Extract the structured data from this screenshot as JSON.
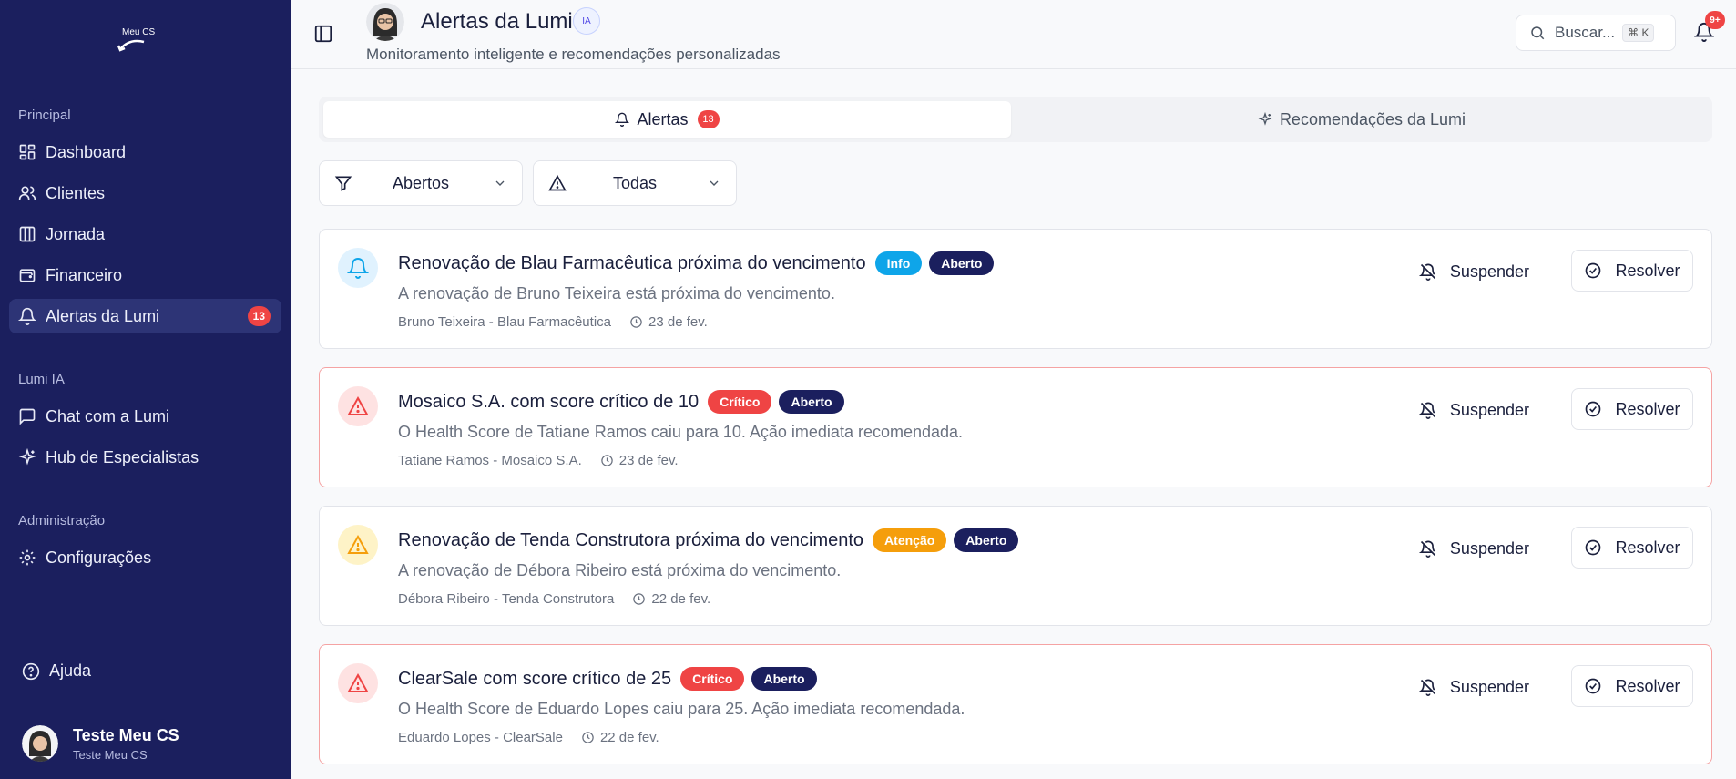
{
  "sidebar": {
    "logo_text": "Meu CS",
    "sections": {
      "principal": "Principal",
      "lumi_ia": "Lumi IA",
      "administracao": "Administração"
    },
    "items": [
      {
        "label": "Dashboard",
        "icon": "dashboard-icon"
      },
      {
        "label": "Clientes",
        "icon": "users-icon"
      },
      {
        "label": "Jornada",
        "icon": "columns-icon"
      },
      {
        "label": "Financeiro",
        "icon": "wallet-icon"
      },
      {
        "label": "Alertas da Lumi",
        "icon": "bell-icon",
        "badge": "13",
        "active": true
      },
      {
        "label": "Chat com a Lumi",
        "icon": "chat-icon"
      },
      {
        "label": "Hub de Especialistas",
        "icon": "sparkles-icon"
      },
      {
        "label": "Configurações",
        "icon": "gear-icon"
      }
    ],
    "help": "Ajuda",
    "user": {
      "name": "Teste Meu CS",
      "sub": "Teste Meu CS"
    }
  },
  "header": {
    "title": "Alertas da Lumi",
    "ia_badge": "IA",
    "subtitle": "Monitoramento inteligente e recomendações personalizadas",
    "search_label": "Buscar...",
    "search_kbd": "⌘ K",
    "notif_badge": "9+"
  },
  "tabs": [
    {
      "label": "Alertas",
      "badge": "13",
      "active": true
    },
    {
      "label": "Recomendações da Lumi",
      "active": false
    }
  ],
  "filters": {
    "status": "Abertos",
    "severity": "Todas"
  },
  "actions": {
    "suspend": "Suspender",
    "resolve": "Resolver"
  },
  "alerts": [
    {
      "title": "Renovação de Blau Farmacêutica próxima do vencimento",
      "severity": "Info",
      "status": "Aberto",
      "description": "A renovação de Bruno Teixeira está próxima do vencimento.",
      "contact": "Bruno Teixeira - Blau Farmacêutica",
      "date": "23 de fev."
    },
    {
      "title": "Mosaico S.A. com score crítico de 10",
      "severity": "Crítico",
      "status": "Aberto",
      "description": "O Health Score de Tatiane Ramos caiu para 10. Ação imediata recomendada.",
      "contact": "Tatiane Ramos - Mosaico S.A.",
      "date": "23 de fev."
    },
    {
      "title": "Renovação de Tenda Construtora próxima do vencimento",
      "severity": "Atenção",
      "status": "Aberto",
      "description": "A renovação de Débora Ribeiro está próxima do vencimento.",
      "contact": "Débora Ribeiro - Tenda Construtora",
      "date": "22 de fev."
    },
    {
      "title": "ClearSale com score crítico de 25",
      "severity": "Crítico",
      "status": "Aberto",
      "description": "O Health Score de Eduardo Lopes caiu para 25. Ação imediata recomendada.",
      "contact": "Eduardo Lopes - ClearSale",
      "date": "22 de fev."
    }
  ],
  "colors": {
    "sidebar_bg": "#1b1f5e",
    "info": "#0ea5e9",
    "critical": "#ef4444",
    "warning": "#f59e0b",
    "status_open": "#1b1f5e"
  }
}
